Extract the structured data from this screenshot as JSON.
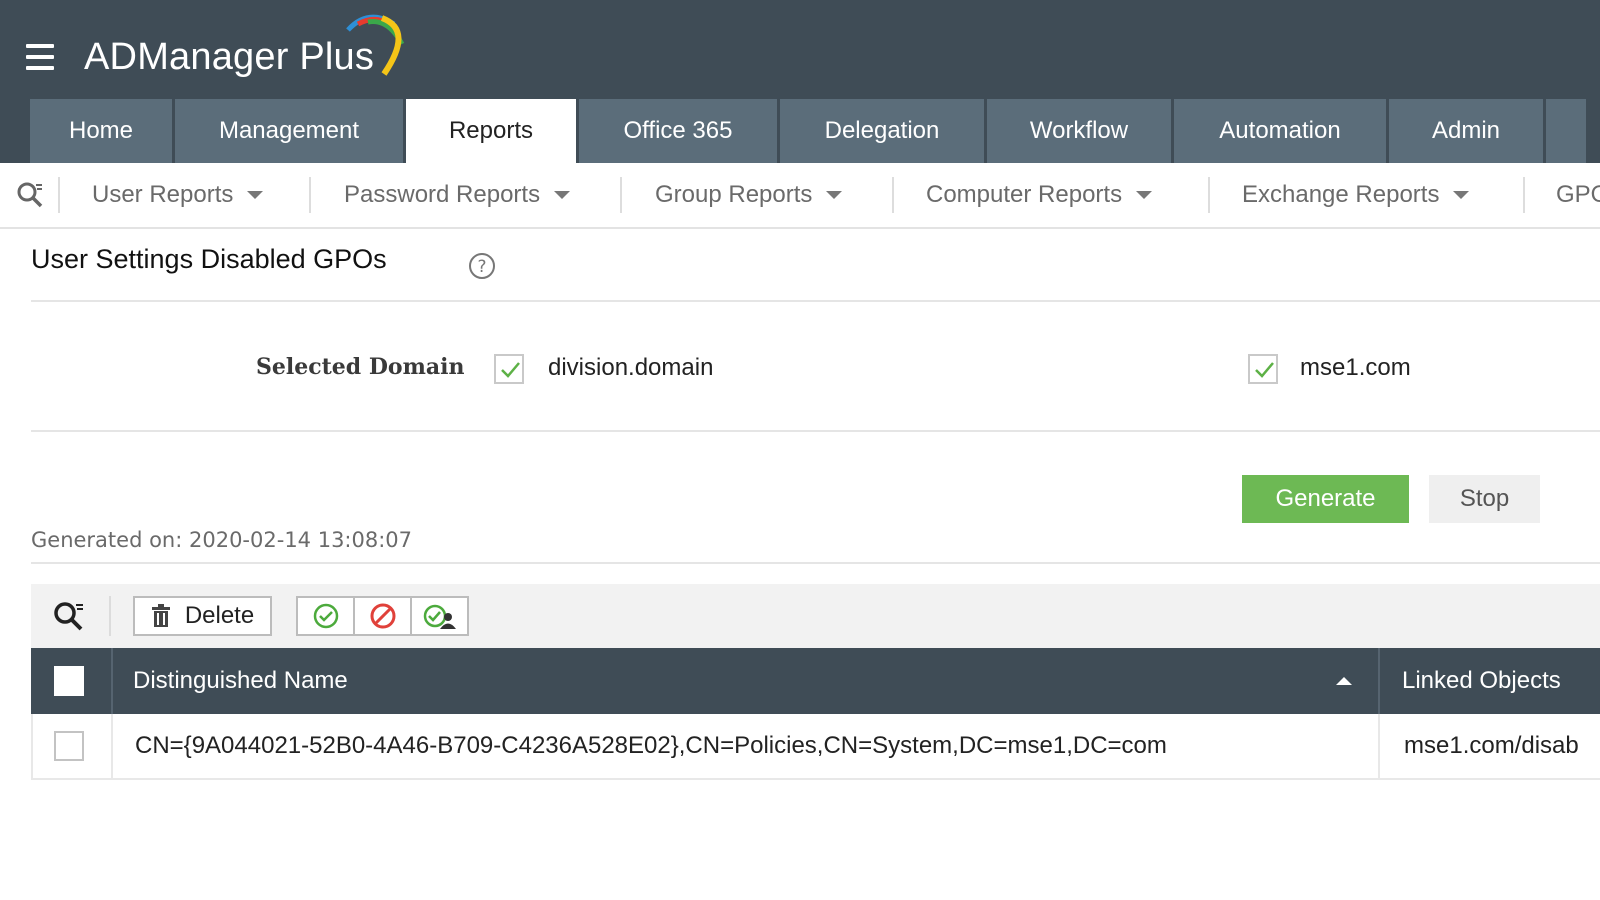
{
  "app": {
    "brand": "ADManager Plus"
  },
  "main_tabs": [
    {
      "label": "Home"
    },
    {
      "label": "Management"
    },
    {
      "label": "Reports"
    },
    {
      "label": "Office 365"
    },
    {
      "label": "Delegation"
    },
    {
      "label": "Workflow"
    },
    {
      "label": "Automation"
    },
    {
      "label": "Admin"
    }
  ],
  "active_tab": "Reports",
  "sub_nav": [
    {
      "label": "User Reports"
    },
    {
      "label": "Password Reports"
    },
    {
      "label": "Group Reports"
    },
    {
      "label": "Computer Reports"
    },
    {
      "label": "Exchange Reports"
    },
    {
      "label": "GPO"
    }
  ],
  "page": {
    "title": "User Settings Disabled GPOs",
    "domain_label": "Selected Domain",
    "domains": [
      {
        "name": "division.domain",
        "checked": true
      },
      {
        "name": "mse1.com",
        "checked": true
      }
    ],
    "generate_label": "Generate",
    "stop_label": "Stop",
    "generated_on": "Generated on: 2020-02-14 13:08:07"
  },
  "toolbar": {
    "delete_label": "Delete"
  },
  "table": {
    "columns": [
      "Distinguished Name",
      "Linked Objects"
    ],
    "sort_column": "Distinguished Name",
    "sort_direction": "ascending",
    "rows": [
      {
        "distinguished_name": "CN={9A044021-52B0-4A46-B709-C4236A528E02},CN=Policies,CN=System,DC=mse1,DC=com",
        "linked_objects": "mse1.com/disab"
      }
    ]
  },
  "colors": {
    "header_bg": "#3f4c56",
    "tab_bg": "#5b6d7a",
    "accent_green": "#6db954",
    "stop_red": "#e0413a"
  }
}
